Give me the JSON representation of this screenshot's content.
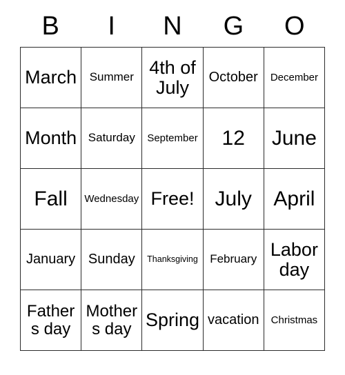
{
  "card": {
    "header": [
      "B",
      "I",
      "N",
      "G",
      "O"
    ],
    "rows": [
      [
        {
          "text": "March",
          "size": "fs-xl"
        },
        {
          "text": "Summer",
          "size": "fs-sm"
        },
        {
          "text": "4th of July",
          "size": "fs-xl"
        },
        {
          "text": "October",
          "size": "fs-md"
        },
        {
          "text": "December",
          "size": "fs-xs"
        }
      ],
      [
        {
          "text": "Month",
          "size": "fs-xl"
        },
        {
          "text": "Saturday",
          "size": "fs-sm"
        },
        {
          "text": "September",
          "size": "fs-xs"
        },
        {
          "text": "12",
          "size": "fs-xxl"
        },
        {
          "text": "June",
          "size": "fs-xxl"
        }
      ],
      [
        {
          "text": "Fall",
          "size": "fs-xxl"
        },
        {
          "text": "Wednesday",
          "size": "fs-xs"
        },
        {
          "text": "Free!",
          "size": "fs-xl"
        },
        {
          "text": "July",
          "size": "fs-xxl"
        },
        {
          "text": "April",
          "size": "fs-xxl"
        }
      ],
      [
        {
          "text": "January",
          "size": "fs-md"
        },
        {
          "text": "Sunday",
          "size": "fs-md"
        },
        {
          "text": "Thanksgiving",
          "size": "fs-xxs"
        },
        {
          "text": "February",
          "size": "fs-sm"
        },
        {
          "text": "Labor day",
          "size": "fs-xl"
        }
      ],
      [
        {
          "text": "Fathers day",
          "size": "fs-lg"
        },
        {
          "text": "Mothers day",
          "size": "fs-lg"
        },
        {
          "text": "Spring",
          "size": "fs-xl"
        },
        {
          "text": "vacation",
          "size": "fs-md"
        },
        {
          "text": "Christmas",
          "size": "fs-xs"
        }
      ]
    ],
    "free_space": {
      "row": 2,
      "col": 2,
      "label": "Free!"
    },
    "colors": {
      "border": "#2b2b2b",
      "text": "#000000",
      "background": "#ffffff"
    }
  }
}
